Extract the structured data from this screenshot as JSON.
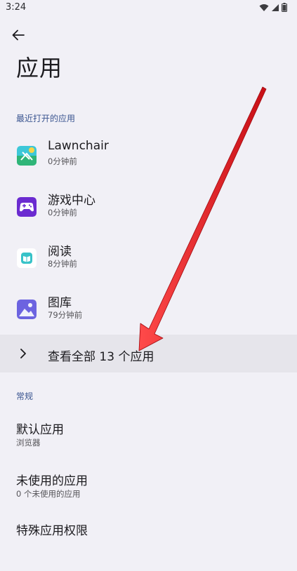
{
  "status_bar": {
    "time": "3:24",
    "icons": [
      "wifi-icon",
      "signal-icon",
      "battery-icon"
    ]
  },
  "header": {
    "back_icon": "arrow-left-icon",
    "title": "应用"
  },
  "recent_section": {
    "header": "最近打开的应用",
    "apps": [
      {
        "name": "Lawnchair",
        "time": "0分钟前",
        "icon": "lawnchair-icon"
      },
      {
        "name": "游戏中心",
        "time": "0分钟前",
        "icon": "game-center-icon"
      },
      {
        "name": "阅读",
        "time": "8分钟前",
        "icon": "reader-icon"
      },
      {
        "name": "图库",
        "time": "79分钟前",
        "icon": "gallery-icon"
      }
    ],
    "see_all": "查看全部 13 个应用"
  },
  "general_section": {
    "header": "常规",
    "items": [
      {
        "title": "默认应用",
        "subtitle": "浏览器"
      },
      {
        "title": "未使用的应用",
        "subtitle": "0 个未使用的应用"
      },
      {
        "title": "特殊应用权限",
        "subtitle": ""
      }
    ]
  },
  "colors": {
    "background": "#f1f0f6",
    "section_header": "#3a5590",
    "highlight_row": "#e6e5eb",
    "annotation_arrow": "#e8141c"
  }
}
